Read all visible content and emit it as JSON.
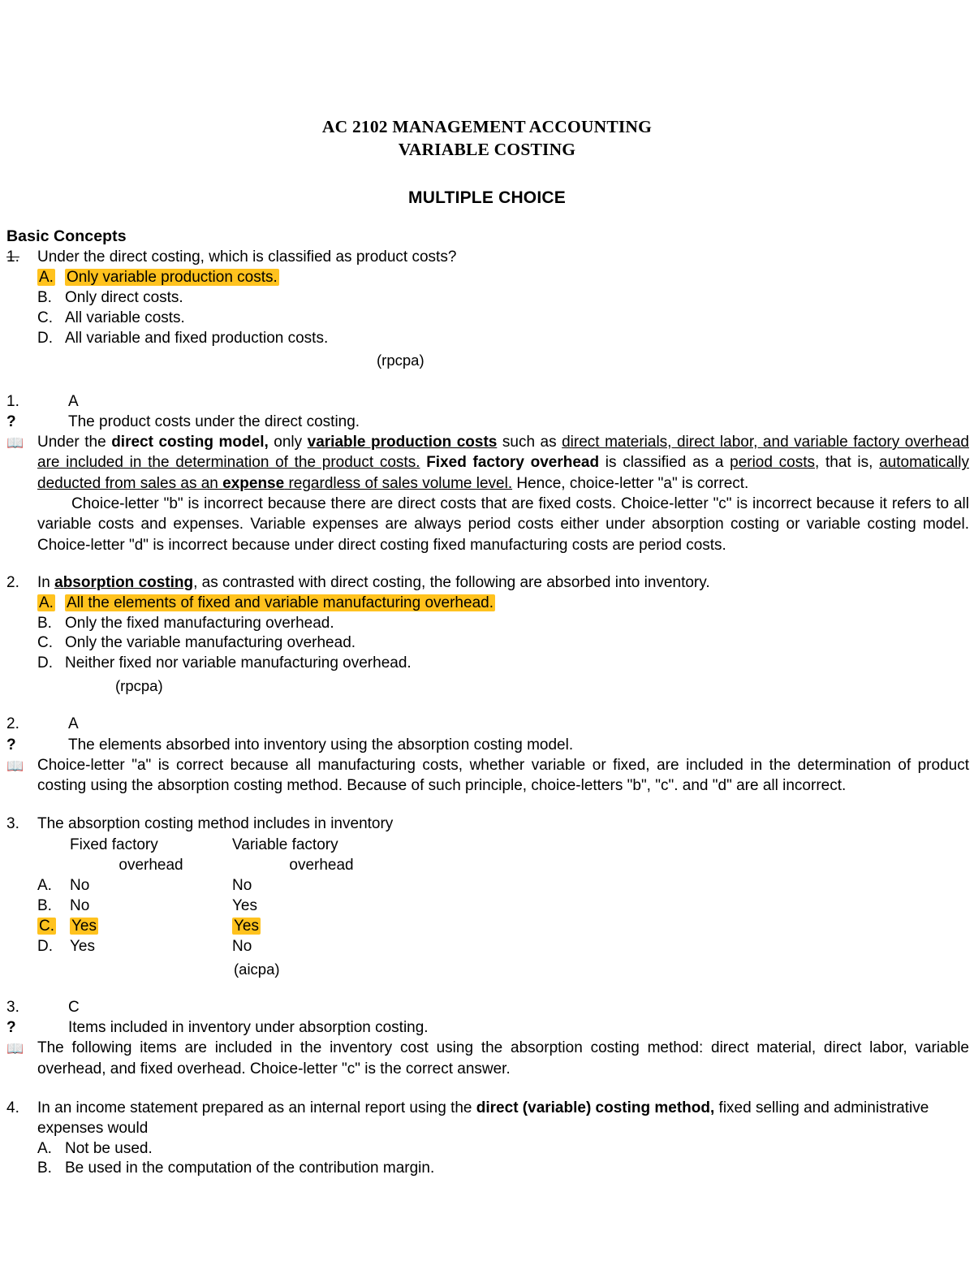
{
  "document": {
    "title_line1": "AC 2102 MANAGEMENT ACCOUNTING",
    "title_line2": "VARIABLE COSTING",
    "section_title": "MULTIPLE CHOICE",
    "heading": "Basic Concepts",
    "highlight_color": "#FFC21E",
    "book_icon": "📖",
    "question_mark": "?"
  },
  "q1": {
    "number": "1.",
    "stem": "Under the direct costing, which is classified as product costs?",
    "choices": [
      {
        "letter": "A.",
        "text": "Only variable production costs.",
        "highlighted": true
      },
      {
        "letter": "B.",
        "text": "Only direct costs.",
        "highlighted": false
      },
      {
        "letter": "C.",
        "text": "All variable costs.",
        "highlighted": false
      },
      {
        "letter": "D.",
        "text": "All variable and fixed production costs.",
        "highlighted": false
      }
    ],
    "source": "(rpcpa)"
  },
  "a1": {
    "number": "1.",
    "answer": "A",
    "topic": "The product costs under the direct costing.",
    "p1_s1": "Under the ",
    "p1_s2": "direct costing model,",
    "p1_s3": " only ",
    "p1_s4": "variable production costs",
    "p1_s5": " such as ",
    "p1_s6": "direct materials, direct labor, and variable factory overhead are included in the determination of the product costs.",
    "p1_s7": "  ",
    "p1_s8": "Fixed factory overhead",
    "p1_s9": " is classified as a ",
    "p1_s10": "period costs",
    "p1_s11": ", that is, ",
    "p1_s12": "automatically deducted from sales as an ",
    "p1_s13": "expense",
    "p1_s14": " regardless of sales volume level.",
    "p1_s15": "  Hence, choice-letter \"a\" is correct.",
    "p2": "Choice-letter \"b\" is incorrect because there are direct costs that are fixed costs.  Choice-letter \"c\" is incorrect because it refers to all variable costs and expenses. Variable expenses are always period costs either under absorption costing or variable costing model.  Choice-letter \"d\" is incorrect because under direct costing fixed manufacturing costs are period costs."
  },
  "q2": {
    "number": "2.",
    "stem_s1": "In ",
    "stem_s2": "absorption costing",
    "stem_s3": ", as contrasted with direct costing, the following are absorbed into inventory.",
    "choices": [
      {
        "letter": "A.",
        "text": "All the elements of fixed and variable manufacturing overhead.",
        "highlighted": true
      },
      {
        "letter": "B.",
        "text": "Only the fixed manufacturing overhead.",
        "highlighted": false
      },
      {
        "letter": "C.",
        "text": "Only the variable manufacturing overhead.",
        "highlighted": false
      },
      {
        "letter": "D.",
        "text": "Neither fixed nor variable manufacturing overhead.",
        "highlighted": false
      }
    ],
    "source": "(rpcpa)"
  },
  "a2": {
    "number": "2.",
    "answer": "A",
    "topic": "The elements absorbed into inventory using the absorption costing model.",
    "p1": "Choice-letter \"a\" is correct because all manufacturing costs, whether variable or fixed, are included in the determination of product costing using the absorption costing method.  Because of such principle, choice-letters \"b\", \"c\". and \"d\" are all incorrect."
  },
  "q3": {
    "number": "3.",
    "stem": "The absorption costing method includes in inventory",
    "table": {
      "header_a_line1": "Fixed factory",
      "header_a_line2": "overhead",
      "header_b_line1": "Variable factory",
      "header_b_line2": "overhead",
      "rows": [
        {
          "letter": "A.",
          "fixed": "No",
          "variable": "No",
          "highlighted": false
        },
        {
          "letter": "B.",
          "fixed": "No",
          "variable": "Yes",
          "highlighted": false
        },
        {
          "letter": "C.",
          "fixed": "Yes",
          "variable": "Yes",
          "highlighted": true
        },
        {
          "letter": "D.",
          "fixed": "Yes",
          "variable": "No",
          "highlighted": false
        }
      ]
    },
    "source": "(aicpa)"
  },
  "a3": {
    "number": "3.",
    "answer": "C",
    "topic": "Items included in inventory under absorption costing.",
    "p1": "The following items are included in the inventory cost using the absorption costing method:  direct material, direct labor, variable overhead, and fixed overhead.  Choice-letter \"c\" is the correct answer."
  },
  "q4": {
    "number": "4.",
    "stem_s1": "In an income statement prepared as an internal report using the ",
    "stem_s2": "direct (variable) costing method,",
    "stem_s3": " fixed selling and administrative expenses would",
    "choices": [
      {
        "letter": "A.",
        "text": "Not be used.",
        "highlighted": false
      },
      {
        "letter": "B.",
        "text": "Be used in the computation of the contribution margin.",
        "highlighted": false
      }
    ]
  }
}
